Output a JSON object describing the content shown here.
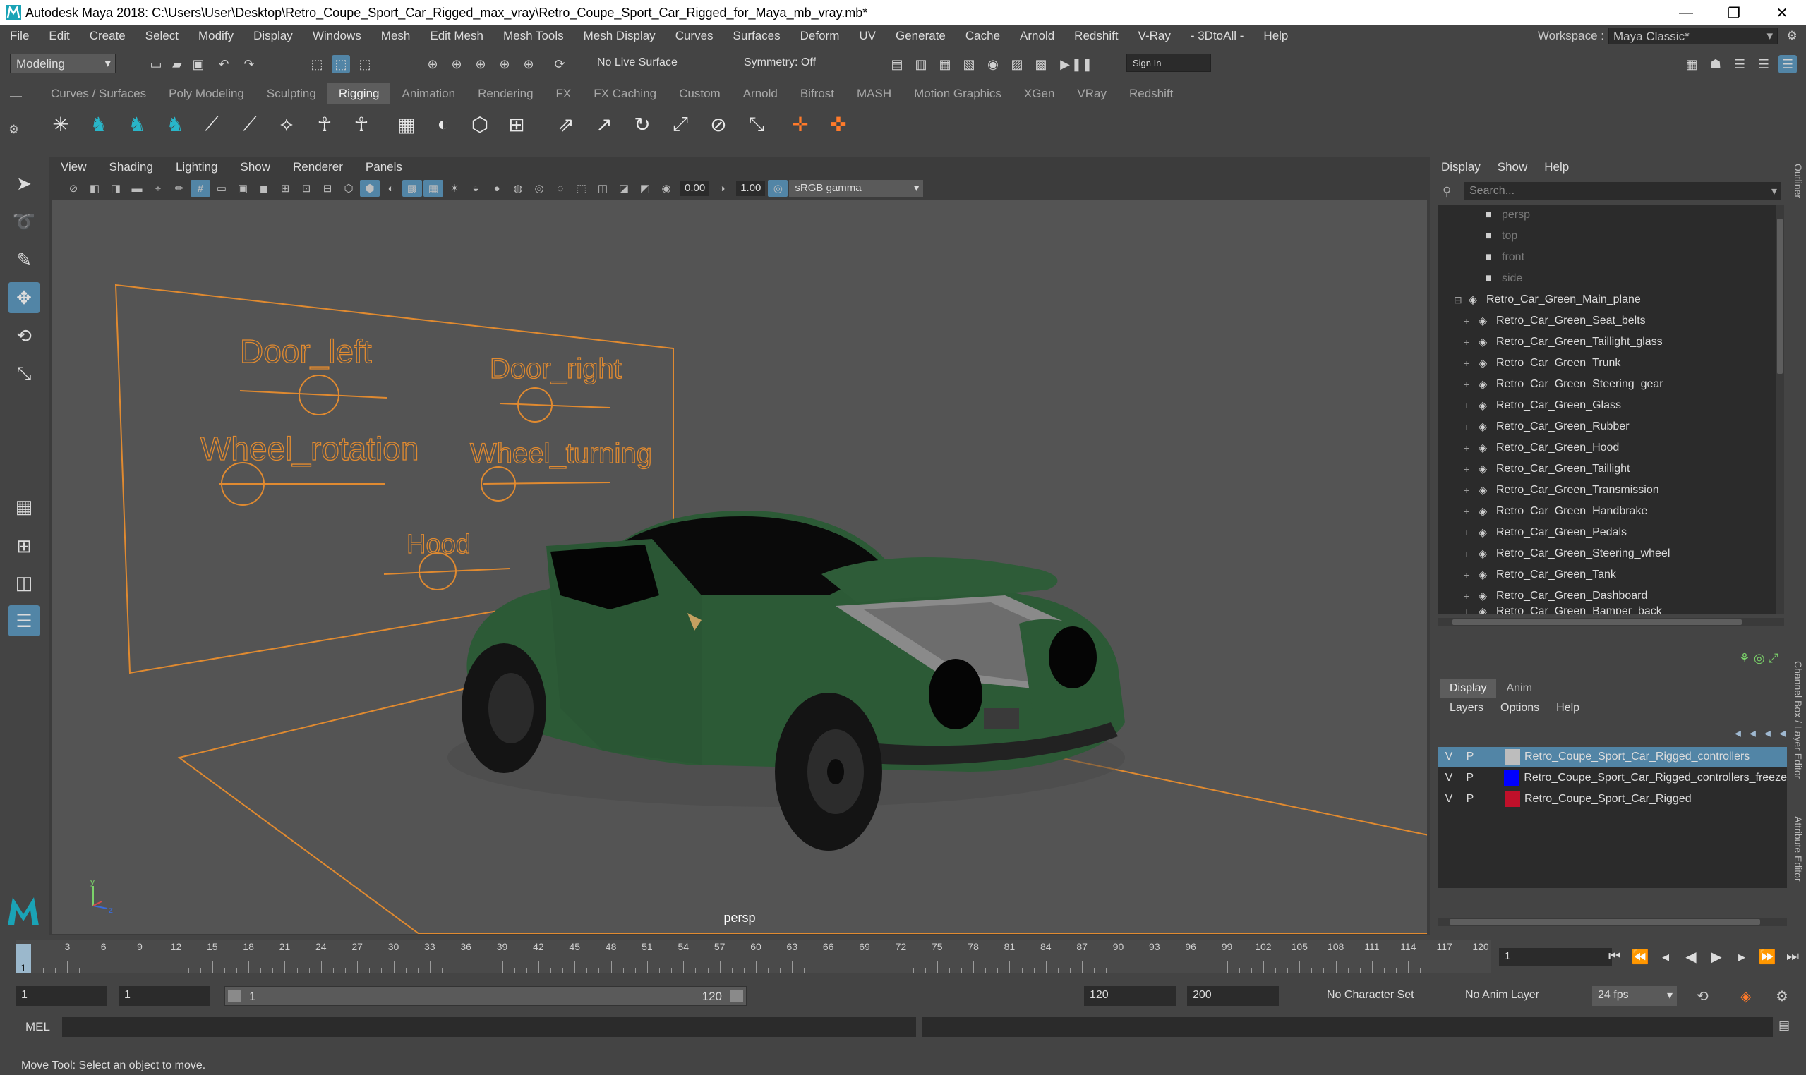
{
  "window": {
    "title": "Autodesk Maya 2018: C:\\Users\\User\\Desktop\\Retro_Coupe_Sport_Car_Rigged_max_vray\\Retro_Coupe_Sport_Car_Rigged_for_Maya_mb_vray.mb*",
    "minimize": "—",
    "restore": "❐",
    "close": "✕"
  },
  "menu": {
    "items": [
      "File",
      "Edit",
      "Create",
      "Select",
      "Modify",
      "Display",
      "Windows",
      "Mesh",
      "Edit Mesh",
      "Mesh Tools",
      "Mesh Display",
      "Curves",
      "Surfaces",
      "Deform",
      "UV",
      "Generate",
      "Cache",
      "Arnold",
      "Redshift",
      "V-Ray",
      "- 3DtoAll -",
      "Help"
    ],
    "workspace_label": "Workspace :",
    "workspace_value": "Maya Classic*"
  },
  "status_line": {
    "mode": "Modeling",
    "live_surface": "No Live Surface",
    "symmetry": "Symmetry: Off",
    "sign_in": "Sign In"
  },
  "shelf": {
    "tabs": [
      "Curves / Surfaces",
      "Poly Modeling",
      "Sculpting",
      "Rigging",
      "Animation",
      "Rendering",
      "FX",
      "FX Caching",
      "Custom",
      "Arnold",
      "Bifrost",
      "MASH",
      "Motion Graphics",
      "XGen",
      "VRay",
      "Redshift"
    ],
    "active_tab": "Rigging"
  },
  "viewport": {
    "menus": [
      "View",
      "Shading",
      "Lighting",
      "Show",
      "Renderer",
      "Panels"
    ],
    "exposure": "0.00",
    "gamma": "1.00",
    "color_space": "sRGB gamma",
    "camera": "persp",
    "controls": {
      "door_left": "Door_left",
      "door_right": "Door_right",
      "wheel_rotation": "Wheel_rotation",
      "wheel_turning": "Wheel_turning",
      "hood": "Hood"
    },
    "axis_y": "y",
    "axis_z": "z",
    "colors": {
      "rig": "#e08a30",
      "car_body": "#2c5a36",
      "background": "#545454"
    }
  },
  "outliner": {
    "menus": [
      "Display",
      "Show",
      "Help"
    ],
    "search_placeholder": "Search...",
    "cameras": [
      "persp",
      "top",
      "front",
      "side"
    ],
    "root": "Retro_Car_Green_Main_plane",
    "children": [
      "Retro_Car_Green_Seat_belts",
      "Retro_Car_Green_Taillight_glass",
      "Retro_Car_Green_Trunk",
      "Retro_Car_Green_Steering_gear",
      "Retro_Car_Green_Glass",
      "Retro_Car_Green_Rubber",
      "Retro_Car_Green_Hood",
      "Retro_Car_Green_Taillight",
      "Retro_Car_Green_Transmission",
      "Retro_Car_Green_Handbrake",
      "Retro_Car_Green_Pedals",
      "Retro_Car_Green_Steering_wheel",
      "Retro_Car_Green_Tank",
      "Retro_Car_Green_Dashboard",
      "Retro_Car_Green_Bamper_back"
    ]
  },
  "layers": {
    "tabs": [
      "Display",
      "Anim"
    ],
    "active_tab": "Display",
    "menus": [
      "Layers",
      "Options",
      "Help"
    ],
    "rows": [
      {
        "v": "V",
        "p": "P",
        "color": "#bdbdbd",
        "name": "Retro_Coupe_Sport_Car_Rigged_controllers",
        "selected": true
      },
      {
        "v": "V",
        "p": "P",
        "color": "#0000ff",
        "name": "Retro_Coupe_Sport_Car_Rigged_controllers_freeze",
        "selected": false
      },
      {
        "v": "V",
        "p": "P",
        "color": "#c0102a",
        "name": "Retro_Coupe_Sport_Car_Rigged",
        "selected": false
      }
    ]
  },
  "side_tabs": [
    "Outliner",
    "Channel Box / Layer Editor",
    "Attribute Editor"
  ],
  "timeline": {
    "ticks": [
      "3",
      "6",
      "9",
      "12",
      "15",
      "18",
      "21",
      "24",
      "27",
      "30",
      "33",
      "36",
      "39",
      "42",
      "45",
      "48",
      "51",
      "54",
      "57",
      "60",
      "63",
      "66",
      "69",
      "72",
      "75",
      "78",
      "81",
      "84",
      "87",
      "90",
      "93",
      "96",
      "99",
      "102",
      "105",
      "108",
      "111",
      "114",
      "117",
      "120"
    ],
    "current_frame": "1",
    "current_field": "1"
  },
  "range": {
    "start": "1",
    "playback_start": "1",
    "slider_start": "1",
    "slider_end": "120",
    "playback_end": "120",
    "end": "200",
    "character_set": "No Character Set",
    "anim_layer": "No Anim Layer",
    "fps": "24 fps"
  },
  "command_line": {
    "label": "MEL"
  },
  "help_line": "Move Tool: Select an object to move."
}
